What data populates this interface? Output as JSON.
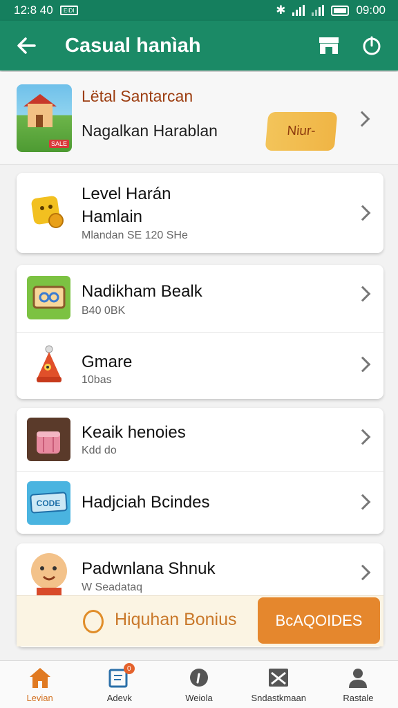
{
  "status_bar": {
    "time_left": "12:8 40",
    "time_right": "09:00",
    "notification_label": "EIDI"
  },
  "app_bar": {
    "title": "Casual hanìah"
  },
  "featured": {
    "title": "Lëtal Santarcan",
    "subtitle": "Nagalkan Harablan",
    "action_label": "Niur-",
    "thumb_tag": "SALE"
  },
  "sections": [
    {
      "items": [
        {
          "title": "Level Harán\nHamlain",
          "subtitle": "Mlandan SE 120 SHe",
          "icon": "trophy-icon"
        }
      ]
    },
    {
      "items": [
        {
          "title": "Nadikham Bealk",
          "subtitle": "B40 0BK",
          "icon": "ticket-icon"
        },
        {
          "title": "Gmare",
          "subtitle": "10bas",
          "icon": "rocket-icon"
        }
      ]
    },
    {
      "items": [
        {
          "title": "Keaik henoies",
          "subtitle": "Kdd do",
          "icon": "cake-icon"
        },
        {
          "title": "Hadjciah Bcindes",
          "subtitle": "",
          "icon": "code-ticket-icon"
        }
      ]
    },
    {
      "items": [
        {
          "title": "Padwnlana Shnuk",
          "subtitle": "W Seadataq",
          "icon": "mascot-icon"
        }
      ]
    }
  ],
  "bonus": {
    "text": "Hiquhan Bonius",
    "button_label": "BcAQOIDES",
    "accent": "#e5872d"
  },
  "bottom_nav": [
    {
      "label": "Levian",
      "icon": "home-icon",
      "active": true
    },
    {
      "label": "Adevk",
      "icon": "edit-icon",
      "badge": "0"
    },
    {
      "label": "Weiola",
      "icon": "info-icon"
    },
    {
      "label": "Sndastkmaan",
      "icon": "mail-icon"
    },
    {
      "label": "Rastale",
      "icon": "profile-icon"
    }
  ],
  "colors": {
    "primary": "#1b8a66",
    "status_bar": "#157f5e",
    "accent": "#e5872d"
  }
}
